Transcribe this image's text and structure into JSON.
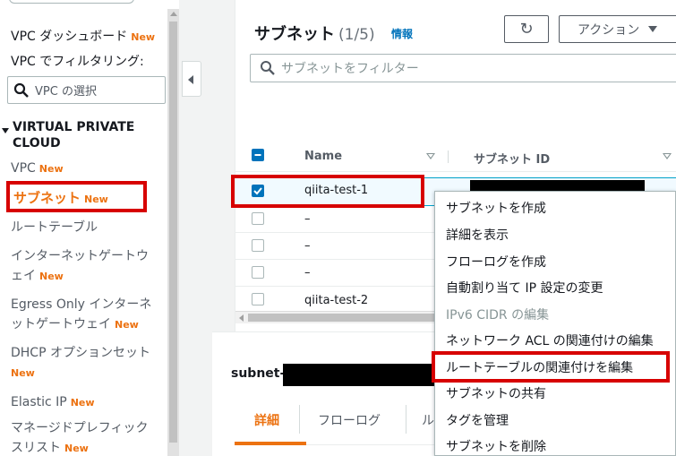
{
  "sidebar": {
    "dashboard_label": "VPC ダッシュボード",
    "dashboard_badge": "New",
    "filter_label": "VPC でフィルタリング:",
    "vpc_select_placeholder": "VPC の選択",
    "section_title_1": "VIRTUAL PRIVATE",
    "section_title_2": "CLOUD",
    "items": [
      {
        "label": "VPC",
        "badge": "New"
      },
      {
        "label": "サブネット",
        "badge": "New",
        "active": true
      },
      {
        "label": "ルートテーブル",
        "badge": ""
      },
      {
        "label_1": "インターネットゲートウ",
        "label_2": "ェイ",
        "badge": "New"
      },
      {
        "label_1": "Egress Only インターネ",
        "label_2": "ットゲートウェイ",
        "badge": "New"
      },
      {
        "label_1": "DHCP オプションセット",
        "badge": "New"
      },
      {
        "label": "Elastic IP",
        "badge": "New"
      },
      {
        "label_1": "マネージドプレフィック",
        "label_2": "スリスト",
        "badge": "New"
      }
    ]
  },
  "header": {
    "title": "サブネット",
    "count": "(1/5)",
    "info": "情報",
    "refresh_icon": "↻",
    "actions_label": "アクション"
  },
  "filter": {
    "placeholder": "サブネットをフィルター"
  },
  "table": {
    "columns": [
      "Name",
      "サブネット ID"
    ],
    "rows": [
      {
        "name": "qiita-test-1",
        "checked": true
      },
      {
        "name": "–",
        "checked": false
      },
      {
        "name": "–",
        "checked": false
      },
      {
        "name": "–",
        "checked": false
      },
      {
        "name": "qiita-test-2",
        "checked": false
      }
    ]
  },
  "context_menu": {
    "items": [
      {
        "label": "サブネットを作成",
        "disabled": false
      },
      {
        "label": "詳細を表示",
        "disabled": false
      },
      {
        "label": "フローログを作成",
        "disabled": false
      },
      {
        "label": "自動割り当て IP 設定の変更",
        "disabled": false
      },
      {
        "label": "IPv6 CIDR の編集",
        "disabled": true
      },
      {
        "label": "ネットワーク ACL の関連付けの編集",
        "disabled": false
      },
      {
        "label": "ルートテーブルの関連付けを編集",
        "disabled": false,
        "highlighted": true
      },
      {
        "label": "サブネットの共有",
        "disabled": false
      },
      {
        "label": "タグを管理",
        "disabled": false
      },
      {
        "label": "サブネットを削除",
        "disabled": false
      }
    ]
  },
  "detail": {
    "id_prefix": "subnet-",
    "tabs": [
      "詳細",
      "フローログ",
      "ル"
    ]
  },
  "colors": {
    "accent_orange": "#ec7211",
    "link_blue": "#0073bb",
    "annotation_red": "#d70000"
  }
}
